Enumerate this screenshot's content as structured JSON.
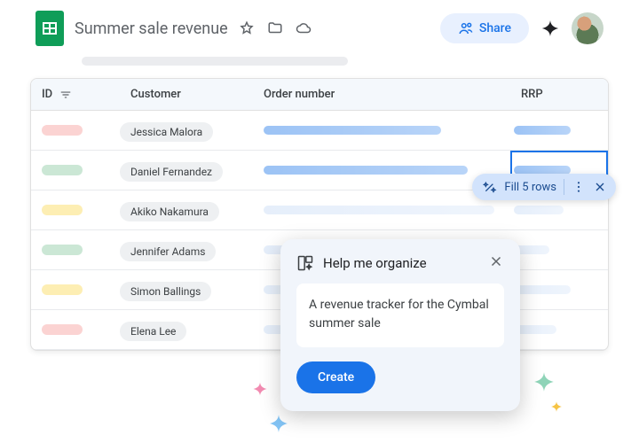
{
  "header": {
    "title": "Summer sale revenue",
    "share_label": "Share"
  },
  "columns": {
    "id": "ID",
    "customer": "Customer",
    "order": "Order number",
    "rrp": "RRP"
  },
  "rows": [
    {
      "id_color": "red",
      "customer": "Jessica Malora",
      "order_w": 200,
      "rrp_w": 64
    },
    {
      "id_color": "green",
      "customer": "Daniel Fernandez",
      "order_w": 230,
      "rrp_w": 64,
      "rrp_selected": true
    },
    {
      "id_color": "yellow",
      "customer": "Akiko Nakamura",
      "order_w": 260,
      "rrp_w": 56,
      "faded": true
    },
    {
      "id_color": "green",
      "customer": "Jennifer Adams",
      "order_w": 250,
      "rrp_w": 40,
      "faded": true
    },
    {
      "id_color": "yellow",
      "customer": "Simon Ballings",
      "order_w": 40,
      "rrp_w": 64,
      "faded": true
    },
    {
      "id_color": "red",
      "customer": "Elena Lee",
      "order_w": 64,
      "rrp_w": 48,
      "faded": true
    }
  ],
  "fill_chip": {
    "label": "Fill 5 rows"
  },
  "panel": {
    "title": "Help me organize",
    "prompt": "A revenue tracker for the Cymbal summer sale",
    "create_label": "Create"
  }
}
